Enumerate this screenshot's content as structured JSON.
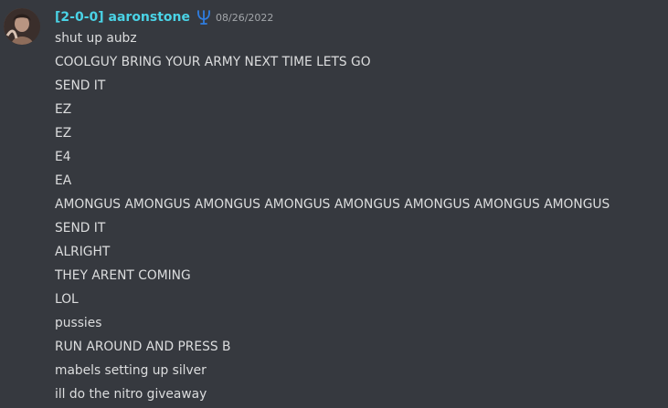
{
  "author": {
    "display_name": "[2-0-0] aaronstone",
    "name_color": "#4ad3e6",
    "role_icon": "trident-icon",
    "avatar": "avatar-image"
  },
  "timestamp": "08/26/2022",
  "messages": [
    "shut up aubz",
    "COOLGUY BRING YOUR ARMY NEXT TIME LETS GO",
    "SEND IT",
    "EZ",
    "EZ",
    "E4",
    "EA",
    "AMONGUS AMONGUS AMONGUS AMONGUS AMONGUS AMONGUS AMONGUS AMONGUS",
    "SEND IT",
    "ALRIGHT",
    "THEY ARENT COMING",
    "LOL",
    "pussies",
    "RUN AROUND AND PRESS B",
    "mabels setting up silver",
    "ill do the nitro giveaway"
  ],
  "colors": {
    "background": "#36393f",
    "text": "#dcddde",
    "timestamp": "#a3a6aa",
    "role_icon": "#2f7de0"
  }
}
